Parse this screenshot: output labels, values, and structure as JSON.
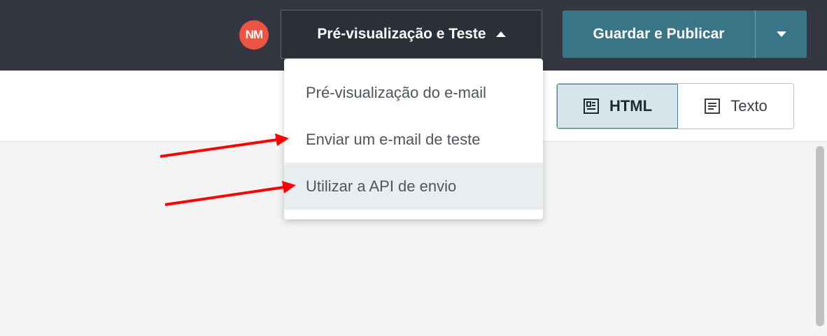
{
  "topbar": {
    "avatar_initials": "NM",
    "preview_toggle_label": "Pré-visualização e Teste",
    "publish_label": "Guardar e Publicar"
  },
  "dropdown": {
    "items": [
      {
        "label": "Pré-visualização do e-mail"
      },
      {
        "label": "Enviar um e-mail de teste"
      },
      {
        "label": "Utilizar a API de envio"
      }
    ]
  },
  "view_toggle": {
    "html_label": "HTML",
    "text_label": "Texto",
    "selected": "HTML"
  },
  "colors": {
    "topbar": "#343741",
    "accent": "#397587",
    "avatar": "#ee5442",
    "annotation_arrow": "#ff0000"
  },
  "icons": {
    "preview_caret": "caret-up-icon",
    "publish_more": "caret-down-icon",
    "html_view": "html-layout-icon",
    "text_view": "text-lines-icon"
  }
}
